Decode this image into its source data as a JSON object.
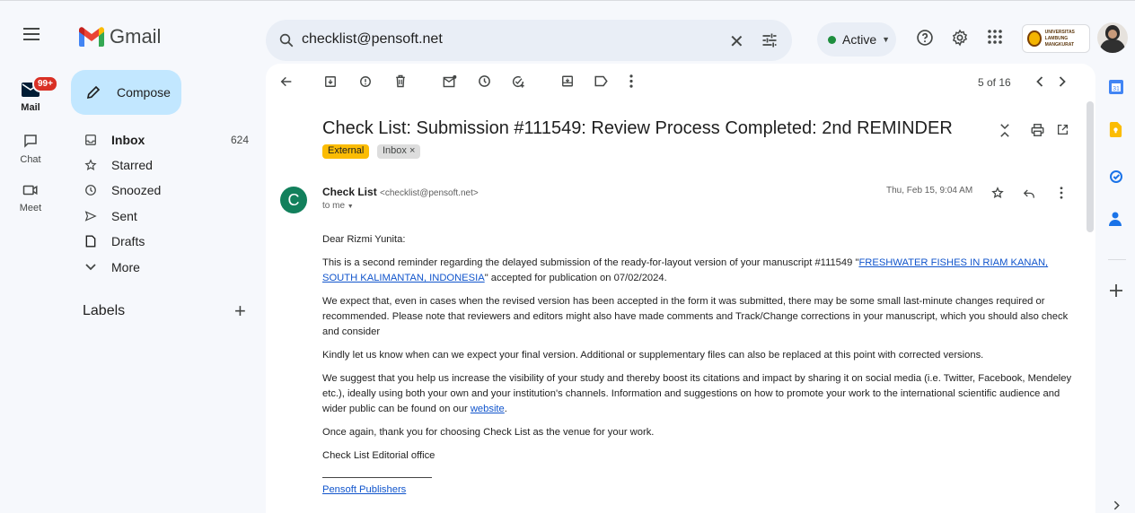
{
  "app": {
    "name": "Gmail",
    "search_value": "checklist@pensoft.net",
    "status": "Active"
  },
  "rail": {
    "mail_label": "Mail",
    "mail_badge": "99+",
    "chat_label": "Chat",
    "meet_label": "Meet"
  },
  "sidebar": {
    "compose": "Compose",
    "items": [
      {
        "label": "Inbox",
        "count": "624",
        "icon": "inbox-icon"
      },
      {
        "label": "Starred",
        "count": "",
        "icon": "star-icon"
      },
      {
        "label": "Snoozed",
        "count": "",
        "icon": "clock-icon"
      },
      {
        "label": "Sent",
        "count": "",
        "icon": "send-icon"
      },
      {
        "label": "Drafts",
        "count": "",
        "icon": "draft-icon"
      },
      {
        "label": "More",
        "count": "",
        "icon": "chevron-down-icon"
      }
    ],
    "labels_heading": "Labels"
  },
  "toolbar": {
    "pager": "5 of 16"
  },
  "email": {
    "subject": "Check List: Submission #111549: Review Process Completed: 2nd REMINDER",
    "chip_external": "External",
    "chip_inbox": "Inbox",
    "chip_inbox_close": "×",
    "sender_initial": "C",
    "sender_name": "Check List",
    "sender_email": "<checklist@pensoft.net>",
    "to_me": "to me",
    "datetime": "Thu, Feb 15, 9:04 AM",
    "body": {
      "greeting": "Dear Rizmi Yunita:",
      "p1_pre": "This is a second reminder regarding the delayed submission of the ready-for-layout version of your manuscript #111549 \"",
      "p1_link": "FRESHWATER FISHES IN RIAM KANAN, SOUTH KALIMANTAN, INDONESIA",
      "p1_post": "\" accepted for publication on 07/02/2024.",
      "p2": "We expect that, even in cases when the revised version has been accepted in the form it was submitted, there may be some small last-minute changes required or recommended. Please note that reviewers and editors might also have made comments and Track/Change corrections in your manuscript, which you should also check and consider",
      "p3": "Kindly let us know when can we expect your final version. Additional or supplementary files can also be replaced at this point with corrected versions.",
      "p4_pre": "We suggest that you help us increase the visibility of your study and thereby boost its citations and impact by sharing it on social media (i.e. Twitter, Facebook, Mendeley etc.), ideally using both your own and your institution's channels. Information and suggestions on how to promote your work to the international scientific audience and wider public can be found on our ",
      "p4_link": "website",
      "p4_post": ".",
      "p5": "Once again, thank you for choosing Check List as the venue for your work.",
      "p6": "Check List Editorial office",
      "signature_link": "Pensoft Publishers"
    }
  },
  "colors": {
    "accent": "#0b57d0",
    "compose_bg": "#c2e7ff",
    "chip_external": "#fbbc04",
    "sender_avatar": "#12805c",
    "link": "#1155cc",
    "badge": "#d93025"
  }
}
